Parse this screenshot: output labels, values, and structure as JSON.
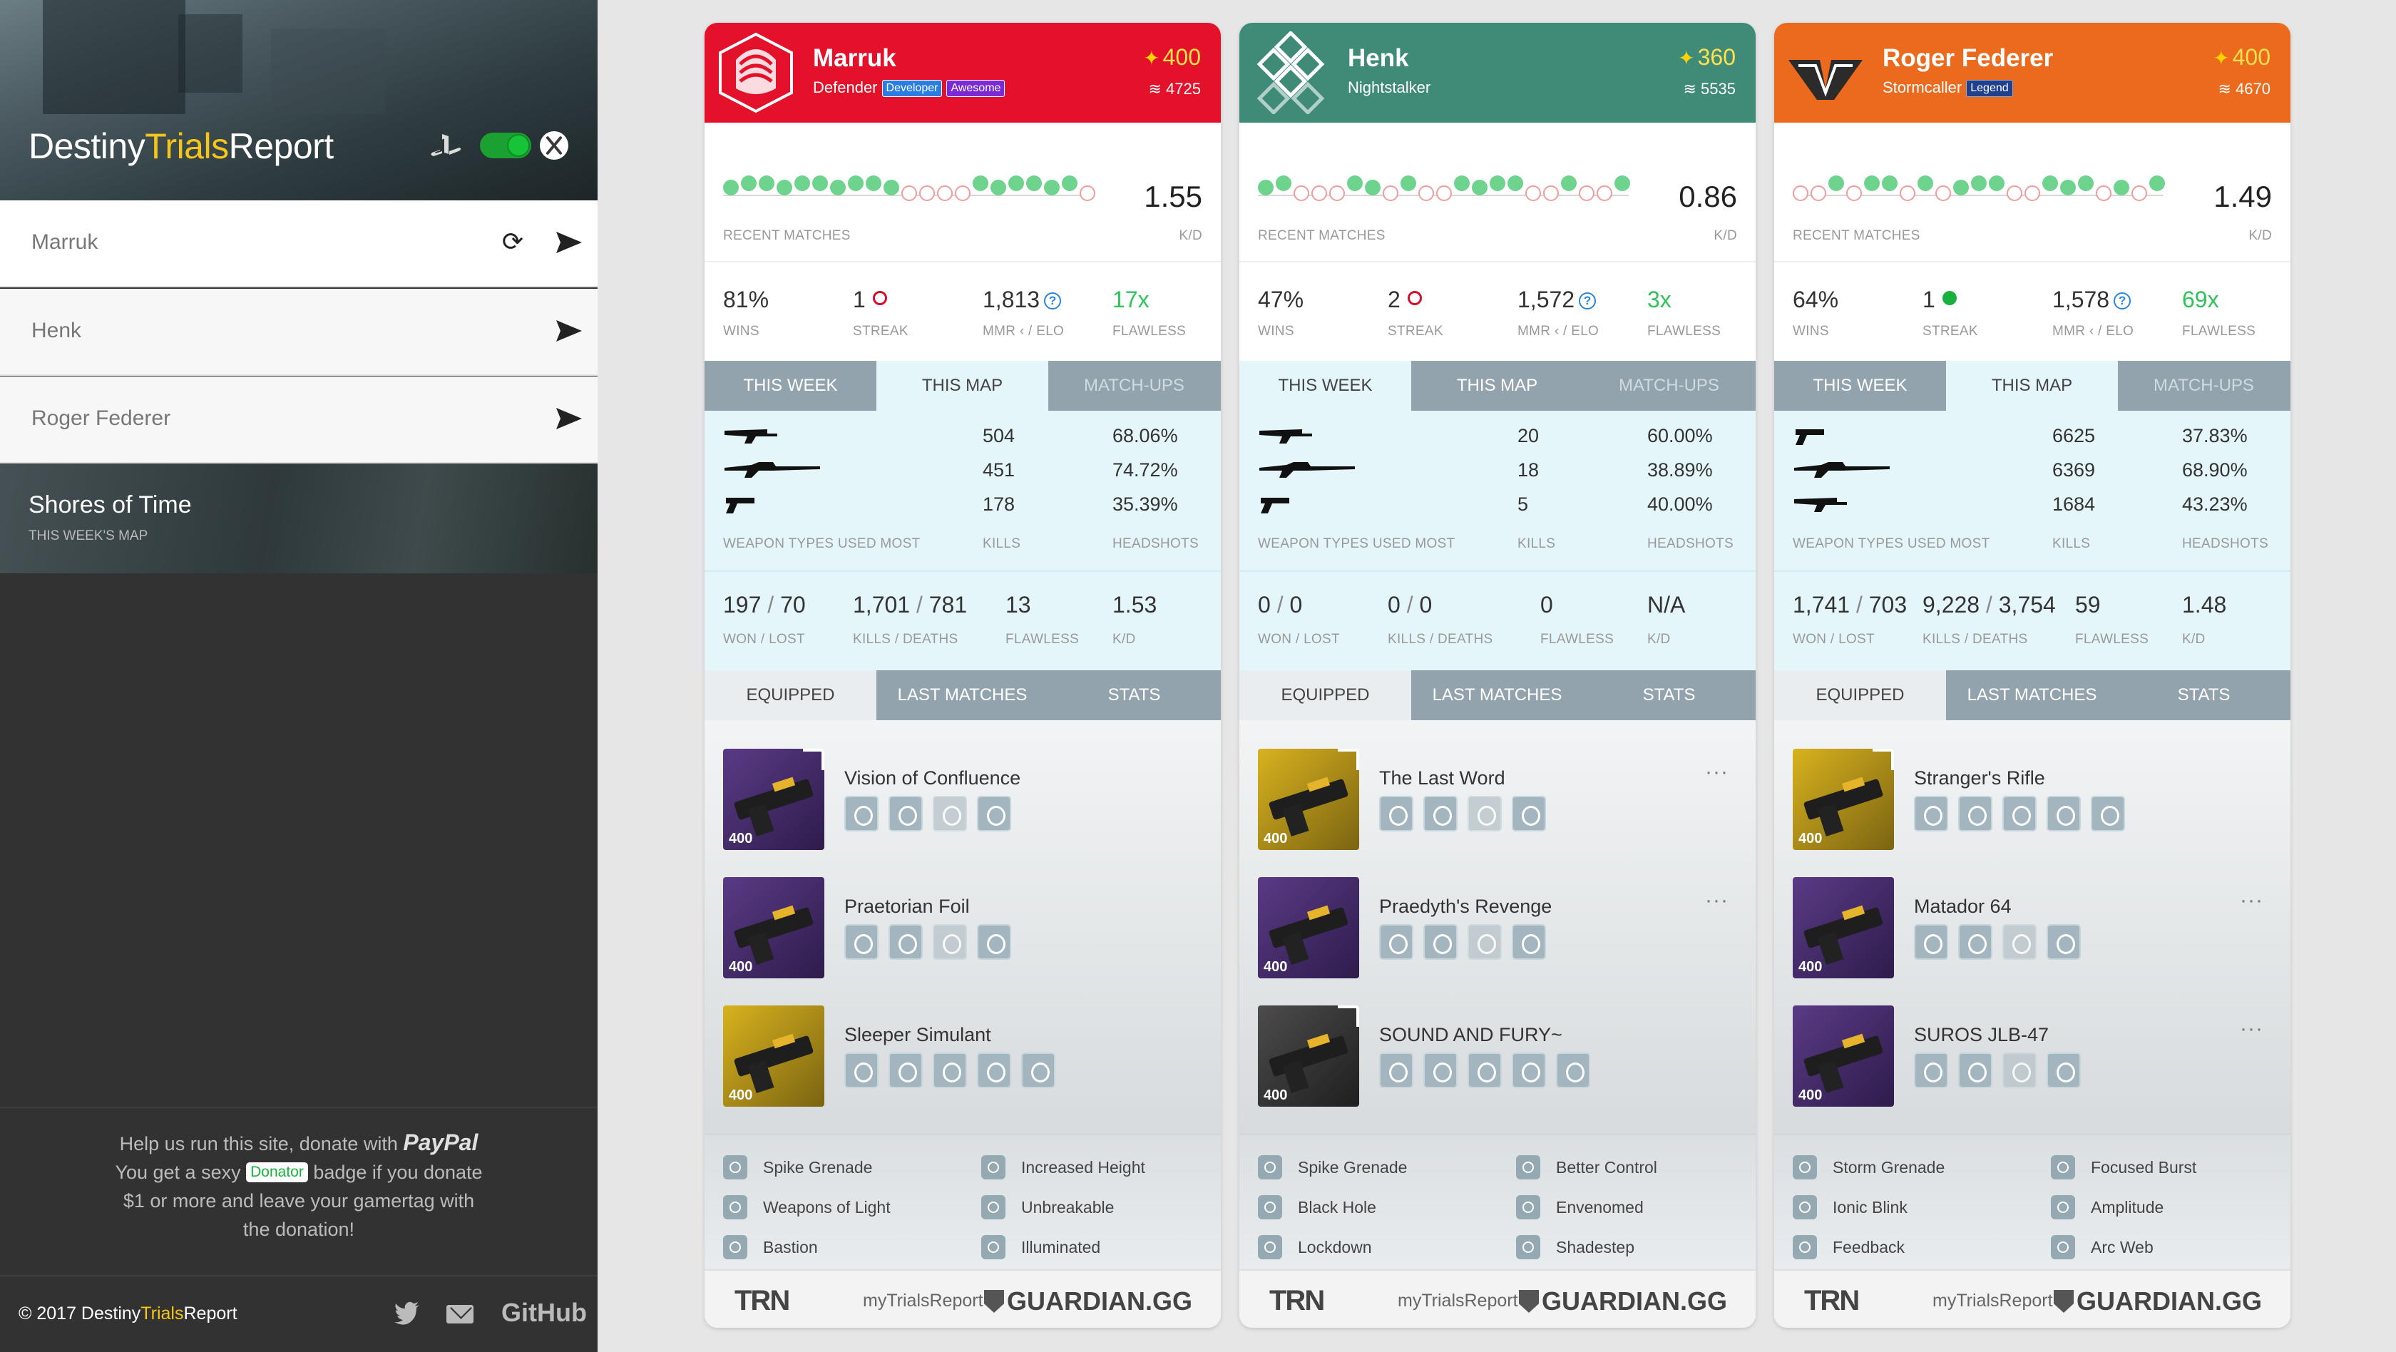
{
  "sidebar": {
    "brand": {
      "part1": "Destiny",
      "part2": "Trials",
      "part3": "Report"
    },
    "platforms": {
      "playstation": "playstation-icon",
      "xbox": "xbox-icon",
      "toggle_state": "xbox"
    },
    "players": [
      {
        "name": "Marruk"
      },
      {
        "name": "Henk"
      },
      {
        "name": "Roger Federer"
      }
    ],
    "map": {
      "name": "Shores of Time",
      "subtitle": "THIS WEEK'S MAP"
    },
    "donate": {
      "line1": "Help us run this site, donate with",
      "paypal": "PayPal",
      "line2a": "You get a sexy",
      "badge": "Donator",
      "line2b": "badge if you donate",
      "line3": "$1 or more and leave your gamertag with",
      "line4": "the donation!"
    },
    "footer": {
      "copyright_a": "© 2017 Destiny",
      "copyright_b": "Trials",
      "copyright_c": "Report",
      "github": "GitHub"
    }
  },
  "labels": {
    "recent_matches": "RECENT MATCHES",
    "kd": "K/D",
    "wins": "WINS",
    "streak": "STREAK",
    "mmr": "MMR ‹ / ELO",
    "flawless": "FLAWLESS",
    "weapon_types": "WEAPON TYPES USED MOST",
    "kills": "KILLS",
    "headshots": "HEADSHOTS",
    "won_lost": "WON / LOST",
    "kills_deaths": "KILLS / DEATHS",
    "flawless_small": "FLAWLESS",
    "kd_small": "K/D",
    "tabs_top": [
      "THIS WEEK",
      "THIS MAP",
      "MATCH-UPS"
    ],
    "tabs_bottom": [
      "EQUIPPED",
      "LAST MATCHES",
      "STATS"
    ],
    "help": "?",
    "more": "···"
  },
  "footer_brands": {
    "trn": "TRN",
    "mytr": "myTrialsReport",
    "gg": "GUARDIAN.GG"
  },
  "cards": [
    {
      "name": "Marruk",
      "class": "Defender",
      "tags": [
        "Developer",
        "Awesome"
      ],
      "tag_colors": [
        "blue",
        "purple"
      ],
      "header_color": "#e4112b",
      "light": "400",
      "grimoire": "4725",
      "matches": [
        "w",
        "w",
        "w",
        "w",
        "w",
        "w",
        "w",
        "w",
        "w",
        "w",
        "l",
        "l",
        "l",
        "l",
        "w",
        "w",
        "w",
        "w",
        "w",
        "w",
        "l"
      ],
      "kd": "1.55",
      "wins": "81%",
      "streak": "1",
      "streak_type": "loss",
      "mmr": "1,813",
      "flawless": "17x",
      "active_top_tab": 1,
      "weapons": [
        {
          "kills": "504",
          "hs": "68.06%"
        },
        {
          "kills": "451",
          "hs": "74.72%"
        },
        {
          "kills": "178",
          "hs": "35.39%"
        }
      ],
      "won": "197",
      "lost": "70",
      "kills": "1,701",
      "deaths": "781",
      "flawless_count": "13",
      "kd_total": "1.53",
      "items": [
        {
          "name": "Vision of Confluence",
          "level": "400",
          "style": "purple",
          "perks": 4,
          "more": false
        },
        {
          "name": "Praetorian Foil",
          "level": "400",
          "style": "purple",
          "perks": 4,
          "more": false
        },
        {
          "name": "Sleeper Simulant",
          "level": "400",
          "style": "gold",
          "perks": 5,
          "more": false
        }
      ],
      "abilities": [
        "Spike Grenade",
        "Increased Height",
        "Weapons of Light",
        "Unbreakable",
        "Bastion",
        "Illuminated"
      ]
    },
    {
      "name": "Henk",
      "class": "Nightstalker",
      "tags": [],
      "tag_colors": [],
      "header_color": "#3f8b78",
      "light": "360",
      "grimoire": "5535",
      "matches": [
        "w",
        "w",
        "l",
        "l",
        "l",
        "w",
        "w",
        "l",
        "w",
        "l",
        "l",
        "w",
        "w",
        "w",
        "w",
        "l",
        "l",
        "w",
        "l",
        "l",
        "w"
      ],
      "kd": "0.86",
      "wins": "47%",
      "streak": "2",
      "streak_type": "loss",
      "mmr": "1,572",
      "flawless": "3x",
      "active_top_tab": 0,
      "weapons": [
        {
          "kills": "20",
          "hs": "60.00%"
        },
        {
          "kills": "18",
          "hs": "38.89%"
        },
        {
          "kills": "5",
          "hs": "40.00%"
        }
      ],
      "won": "0",
      "lost": "0",
      "kills": "0",
      "deaths": "0",
      "flawless_count": "0",
      "kd_total": "N/A",
      "items": [
        {
          "name": "The Last Word",
          "level": "400",
          "style": "gold",
          "perks": 4,
          "more": true
        },
        {
          "name": "Praedyth's Revenge",
          "level": "400",
          "style": "purple",
          "perks": 4,
          "more": true
        },
        {
          "name": "SOUND AND FURY~",
          "level": "400",
          "style": "dark",
          "perks": 5,
          "more": false
        }
      ],
      "abilities": [
        "Spike Grenade",
        "Better Control",
        "Black Hole",
        "Envenomed",
        "Lockdown",
        "Shadestep"
      ]
    },
    {
      "name": "Roger Federer",
      "class": "Stormcaller",
      "tags": [
        "Legend"
      ],
      "tag_colors": [
        "navy"
      ],
      "header_color": "#ec6a1e",
      "light": "400",
      "grimoire": "4670",
      "matches": [
        "l",
        "l",
        "w",
        "l",
        "w",
        "w",
        "l",
        "w",
        "l",
        "w",
        "w",
        "w",
        "l",
        "l",
        "w",
        "w",
        "w",
        "l",
        "w",
        "l",
        "w"
      ],
      "kd": "1.49",
      "wins": "64%",
      "streak": "1",
      "streak_type": "win",
      "mmr": "1,578",
      "flawless": "69x",
      "active_top_tab": 1,
      "weapons": [
        {
          "kills": "6625",
          "hs": "37.83%"
        },
        {
          "kills": "6369",
          "hs": "68.90%"
        },
        {
          "kills": "1684",
          "hs": "43.23%"
        }
      ],
      "won": "1,741",
      "lost": "703",
      "kills": "9,228",
      "deaths": "3,754",
      "flawless_count": "59",
      "kd_total": "1.48",
      "items": [
        {
          "name": "Stranger's Rifle",
          "level": "400",
          "style": "gold",
          "perks": 5,
          "more": false
        },
        {
          "name": "Matador 64",
          "level": "400",
          "style": "purple",
          "perks": 4,
          "more": true
        },
        {
          "name": "SUROS JLB-47",
          "level": "400",
          "style": "purple",
          "perks": 4,
          "more": true
        }
      ],
      "abilities": [
        "Storm Grenade",
        "Focused Burst",
        "Ionic Blink",
        "Amplitude",
        "Feedback",
        "Arc Web"
      ]
    }
  ]
}
